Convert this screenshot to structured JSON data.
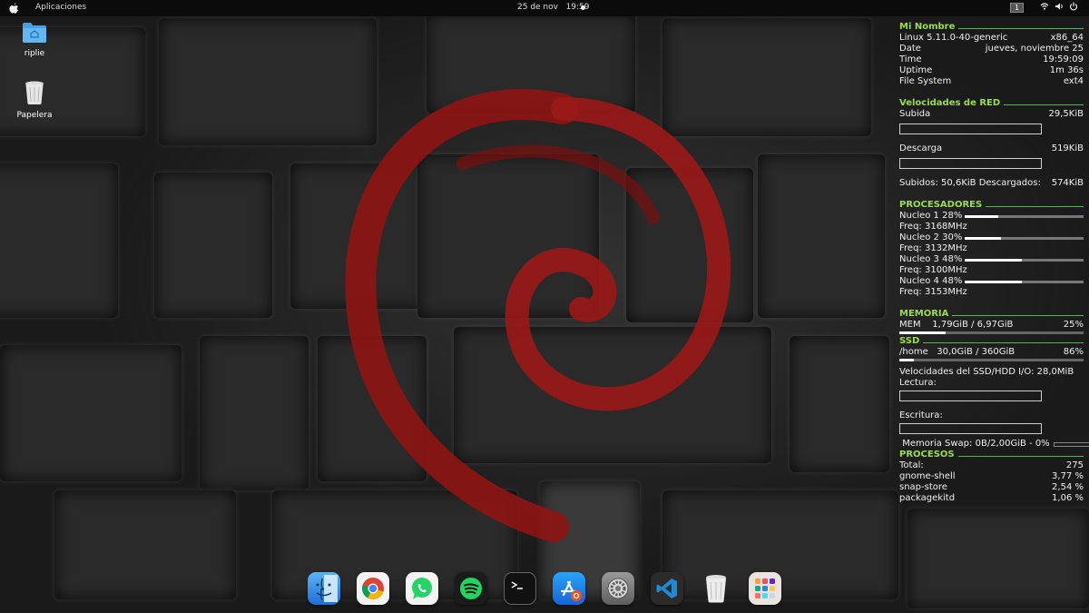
{
  "topbar": {
    "apps_label": "Aplicaciones",
    "date": "25 de nov",
    "time": "19:59",
    "workspace": "1"
  },
  "desktop": {
    "icons": [
      {
        "label": "riplie",
        "icon": "folder-icon"
      },
      {
        "label": "Papelera",
        "icon": "trash-icon"
      }
    ]
  },
  "conky": {
    "system": {
      "title": "Mi Nombre",
      "kernel": "Linux 5.11.0-40-generic",
      "arch": "x86_64",
      "date_label": "Date",
      "date_value": "jueves, noviembre 25",
      "time_label": "Time",
      "time_value": "19:59:09",
      "uptime_label": "Uptime",
      "uptime_value": "1m 36s",
      "fs_label": "File System",
      "fs_value": "ext4"
    },
    "net": {
      "title": "Velocidades de RED",
      "up_label": "Subida",
      "up_value": "29,5KiB",
      "down_label": "Descarga",
      "down_value": "519KiB",
      "totals_up_label": "Subidos:",
      "totals_up": "50,6KiB",
      "totals_down_label": "Descargados:",
      "totals_down": "574KiB"
    },
    "cpu": {
      "title": "PROCESADORES",
      "cores": [
        {
          "label": "Nucleo 1",
          "pct": "28%",
          "value": 28,
          "freq": "Freq: 3168MHz"
        },
        {
          "label": "Nucleo 2",
          "pct": "30%",
          "value": 30,
          "freq": "Freq: 3132MHz"
        },
        {
          "label": "Nucleo 3",
          "pct": "48%",
          "value": 48,
          "freq": "Freq: 3100MHz"
        },
        {
          "label": "Nucleo 4",
          "pct": "48%",
          "value": 48,
          "freq": "Freq: 3153MHz"
        }
      ]
    },
    "mem": {
      "title": "MEMORIA",
      "label": "MEM",
      "used": "1,79GiB / 6,97GiB",
      "pct": "25%",
      "value": 25
    },
    "ssd": {
      "title": "SSD",
      "label": "/home",
      "used": "30,0GiB / 360GiB",
      "pct": "86%",
      "value": 8,
      "io_label": "Velocidades del SSD/HDD I/O:",
      "io_value": "28,0MiB",
      "read_label": "Lectura:",
      "write_label": "Escritura:",
      "swap_label": "Memoria Swap:",
      "swap_used": "0B",
      "swap_total": "/2,00GiB - 0%"
    },
    "proc": {
      "title": "PROCESOS",
      "total_label": "Total:",
      "total": "275",
      "items": [
        {
          "name": "gnome-shell",
          "pct": "3,77 %"
        },
        {
          "name": "snap-store",
          "pct": "2,54 %"
        },
        {
          "name": "packagekitd",
          "pct": "1,06 %"
        }
      ]
    }
  },
  "dock": {
    "apps": [
      "finder-icon",
      "chrome-icon",
      "whatsapp-icon",
      "spotify-icon",
      "terminal-icon",
      "app-store-icon",
      "settings-icon",
      "vscode-icon",
      "trash-icon",
      "app-grid-icon"
    ]
  },
  "colors": {
    "accent_green": "#9bdc4e",
    "swirl_red": "#a01818"
  }
}
